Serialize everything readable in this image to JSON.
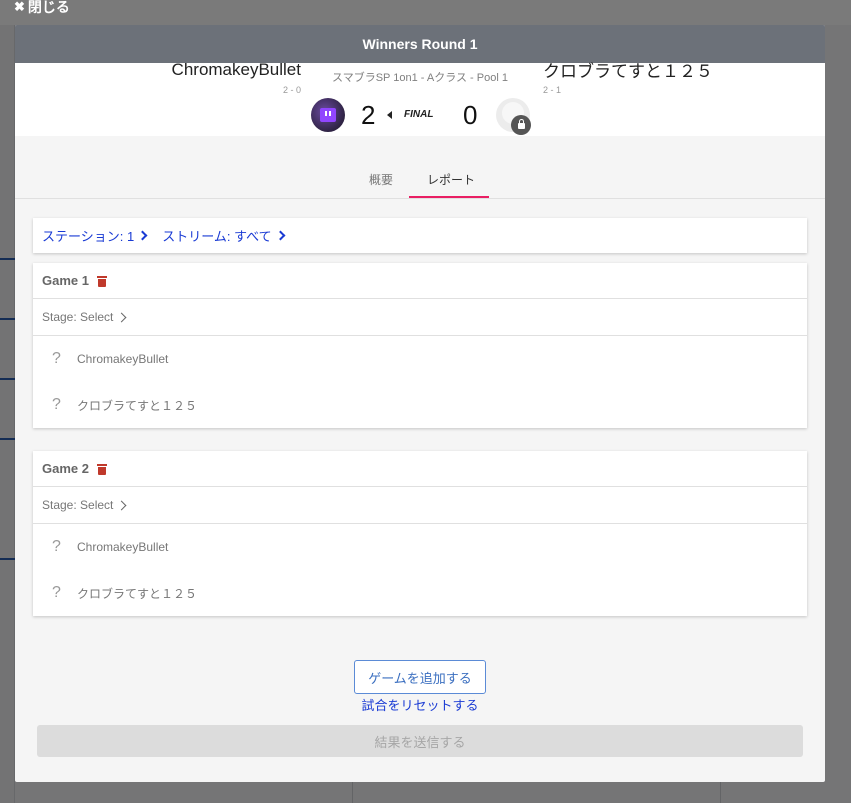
{
  "close": {
    "label": "閉じる"
  },
  "modal": {
    "title": "Winners Round 1"
  },
  "match": {
    "event": "スマブラSP 1on1 - Aクラス - Pool 1",
    "player1": {
      "name": "ChromakeyBullet",
      "record": "2 - 0",
      "score": "2"
    },
    "player2": {
      "name": "クロブラてすと１２５",
      "record": "2 - 1",
      "score": "0"
    },
    "status": "FINAL"
  },
  "tabs": [
    {
      "label": "概要",
      "active": false
    },
    {
      "label": "レポート",
      "active": true
    }
  ],
  "filters": {
    "station": "ステーション: 1",
    "stream": "ストリーム: すべて"
  },
  "games": [
    {
      "title": "Game 1",
      "stage": "Stage: Select",
      "players": [
        {
          "mark": "?",
          "name": "ChromakeyBullet"
        },
        {
          "mark": "?",
          "name": "クロブラてすと１２５"
        }
      ]
    },
    {
      "title": "Game 2",
      "stage": "Stage: Select",
      "players": [
        {
          "mark": "?",
          "name": "ChromakeyBullet"
        },
        {
          "mark": "?",
          "name": "クロブラてすと１２５"
        }
      ]
    }
  ],
  "actions": {
    "add_game": "ゲームを追加する",
    "reset_match": "試合をリセットする",
    "submit": "結果を送信する"
  },
  "colors": {
    "accent_link": "#1a3bd4",
    "tab_underline": "#e91e63",
    "delete": "#c0392b",
    "header_bg": "#6c7179"
  }
}
